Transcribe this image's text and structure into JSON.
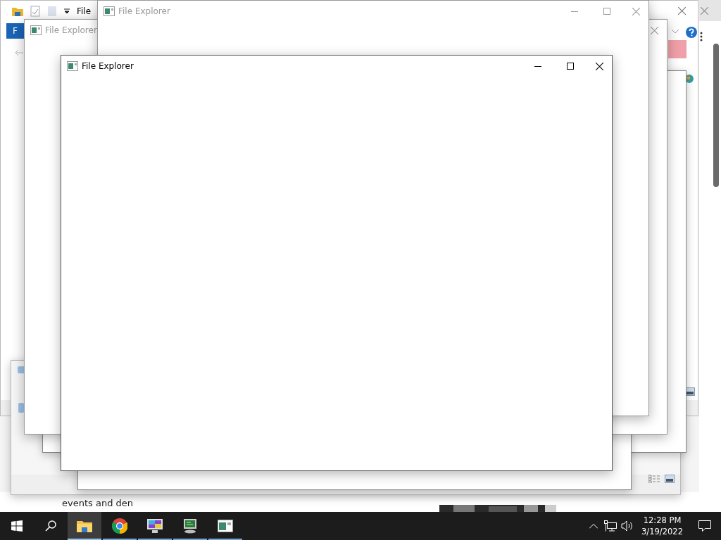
{
  "background_explorer": {
    "title_fragment": "File",
    "tab_fragment": "F"
  },
  "background_text": "events and den",
  "windows": [
    {
      "title": "File Explorer",
      "active": false
    },
    {
      "title": "File Explorer",
      "active": false
    },
    {
      "title": "File Explorer",
      "active": true
    }
  ],
  "taskbar": {
    "apps": [
      {
        "kind": "explorer",
        "selected": true
      },
      {
        "kind": "chrome",
        "selected": false
      },
      {
        "kind": "display",
        "selected": false
      },
      {
        "kind": "monitor",
        "selected": false
      },
      {
        "kind": "window",
        "selected": false
      }
    ],
    "time": "12:28 PM",
    "date": "3/19/2022"
  }
}
